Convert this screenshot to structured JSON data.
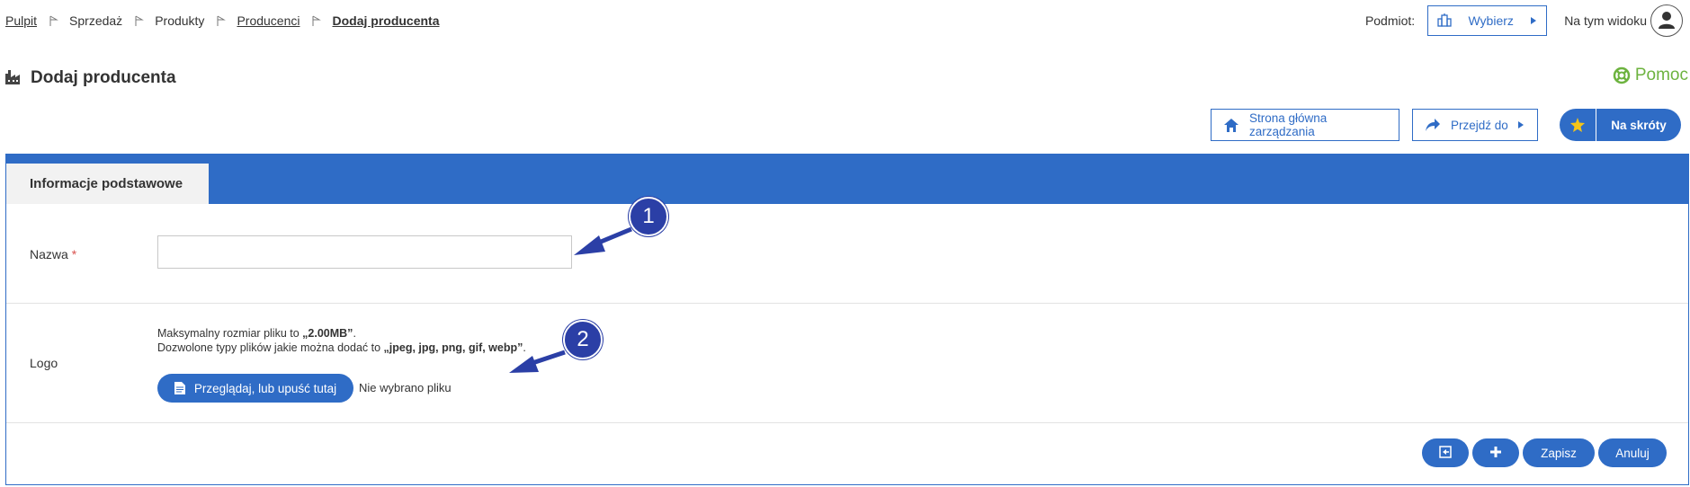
{
  "breadcrumb": {
    "items": [
      "Pulpit",
      "Sprzedaż",
      "Produkty",
      "Producenci",
      "Dodaj producenta"
    ]
  },
  "topbar": {
    "entity_label": "Podmiot:",
    "select_button": "Wybierz",
    "view_label": "Na tym widoku"
  },
  "page": {
    "title": "Dodaj producenta",
    "help": "Pomoc"
  },
  "actions": {
    "home": "Strona główna zarządzania",
    "goto": "Przejdź do",
    "shortcuts": "Na skróty"
  },
  "panel": {
    "tab": "Informacje podstawowe",
    "name": {
      "label": "Nazwa",
      "required": "*",
      "value": ""
    },
    "logo": {
      "label": "Logo",
      "max_size_prefix": "Maksymalny rozmiar pliku to ",
      "max_size_value": "„2.00MB”",
      "max_size_suffix": ".",
      "types_prefix": "Dozwolone typy plików jakie można dodać to ",
      "types_value": "„jpeg, jpg, png, gif, webp”",
      "types_suffix": ".",
      "browse": "Przeglądaj, lub upuść tutaj",
      "no_file": "Nie wybrano pliku"
    },
    "footer": {
      "save": "Zapisz",
      "cancel": "Anuluj"
    }
  },
  "annotations": [
    "1",
    "2"
  ],
  "colors": {
    "primary": "#2f6cc6",
    "help": "#6db33f",
    "callout": "#2b3fa6",
    "required": "#d9534f"
  }
}
